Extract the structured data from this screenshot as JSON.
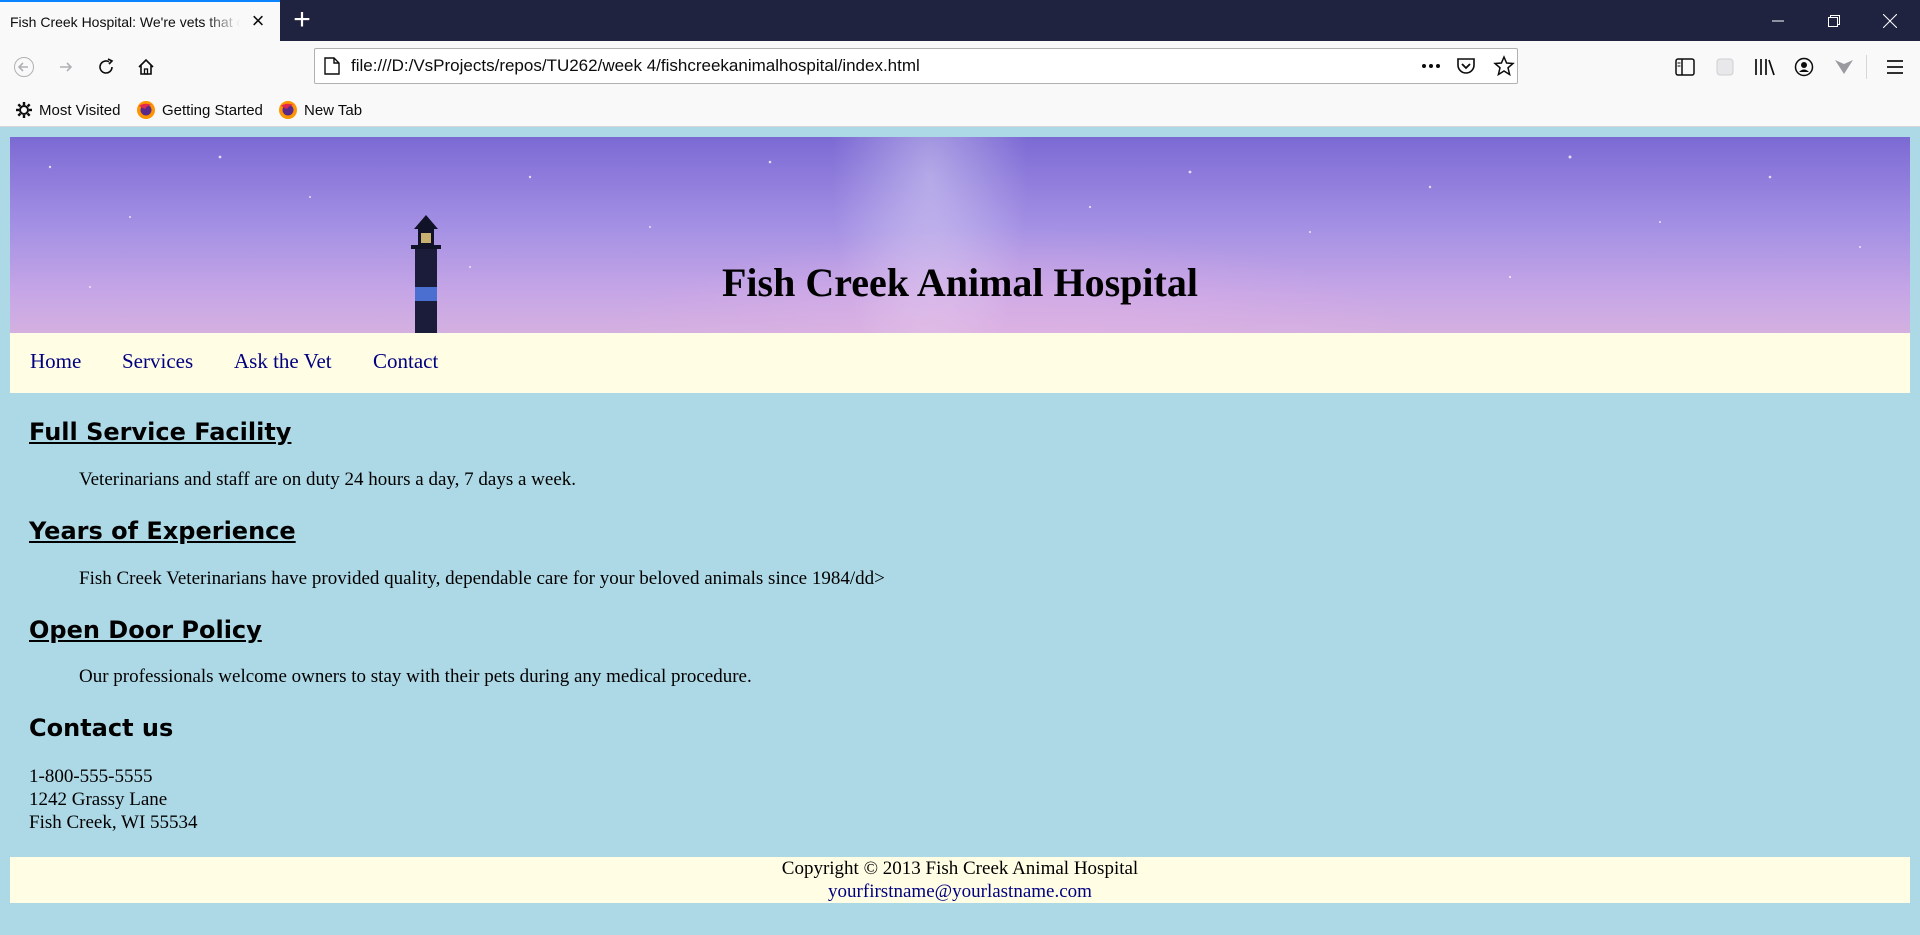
{
  "browser": {
    "tab_title": "Fish Creek Hospital: We're vets that care",
    "url": "file:///D:/VsProjects/repos/TU262/week 4/fishcreekanimalhospital/index.html",
    "bookmarks": [
      "Most Visited",
      "Getting Started",
      "New Tab"
    ]
  },
  "header": {
    "title": "Fish Creek Animal Hospital"
  },
  "nav": {
    "items": [
      "Home",
      "Services",
      "Ask the Vet",
      "Contact"
    ]
  },
  "main": {
    "sections": [
      {
        "heading": "Full Service Facility",
        "text": "Veterinarians and staff are on duty 24 hours a day, 7 days a week."
      },
      {
        "heading": "Years of Experience",
        "text": "Fish Creek Veterinarians have provided quality, dependable care for your beloved animals since 1984/dd>"
      },
      {
        "heading": "Open Door Policy",
        "text": "Our professionals welcome owners to stay with their pets during any medical procedure."
      }
    ],
    "contact": {
      "heading": "Contact us",
      "phone": "1-800-555-5555",
      "street": "1242 Grassy Lane",
      "city": "Fish Creek, WI 55534"
    }
  },
  "footer": {
    "copyright": "Copyright © 2013 Fish Creek Animal Hospital",
    "email": "yourfirstname@yourlastname.com"
  },
  "colors": {
    "page_bg": "#add8e6",
    "nav_bg": "#fffde4",
    "link": "#000080"
  }
}
